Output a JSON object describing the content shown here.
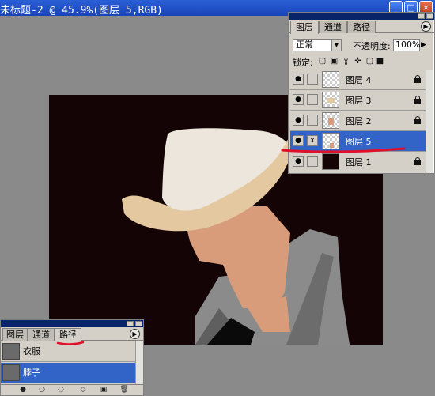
{
  "document": {
    "title": "未标题-2 @ 45.9%(图层 5,RGB)",
    "window_buttons": {
      "minimize": "_",
      "maximize": "□",
      "close": "×"
    }
  },
  "layers_panel": {
    "tabs": [
      {
        "label": "图层"
      },
      {
        "label": "通道"
      },
      {
        "label": "路径"
      }
    ],
    "active_tab": "图层",
    "menu_icon": "triangle-menu-icon",
    "blend_mode": "正常",
    "opacity_label": "不透明度:",
    "opacity_value": "100%",
    "lock_label": "锁定:",
    "layers": [
      {
        "name": "图层 4",
        "visible": true,
        "selected": false,
        "thumb": "transparent"
      },
      {
        "name": "图层 3",
        "visible": true,
        "selected": false,
        "thumb": "hat-shape"
      },
      {
        "name": "图层 2",
        "visible": true,
        "selected": false,
        "thumb": "face-shape"
      },
      {
        "name": "图层 5",
        "visible": true,
        "selected": true,
        "thumb": "transparent-small"
      },
      {
        "name": "图层 1",
        "visible": true,
        "selected": false,
        "thumb": "dark-fill"
      }
    ]
  },
  "paths_panel": {
    "tabs": [
      {
        "label": "图层"
      },
      {
        "label": "通道"
      },
      {
        "label": "路径"
      }
    ],
    "active_tab": "路径",
    "paths": [
      {
        "name": "衣服",
        "selected": false
      },
      {
        "name": "脖子",
        "selected": true
      }
    ],
    "footer_icons": [
      "fill-path-icon",
      "stroke-path-icon",
      "load-selection-icon",
      "make-workpath-icon",
      "new-path-icon",
      "trash-icon"
    ]
  },
  "colors": {
    "canvas_bg": "#140406",
    "hat_light": "#ece6dc",
    "hat_brim": "#e4c9a0",
    "skin": "#d89c7b",
    "shirt": "#8b8b8b",
    "selection_blue": "#3164c6",
    "annotation_red": "#e0102a"
  }
}
